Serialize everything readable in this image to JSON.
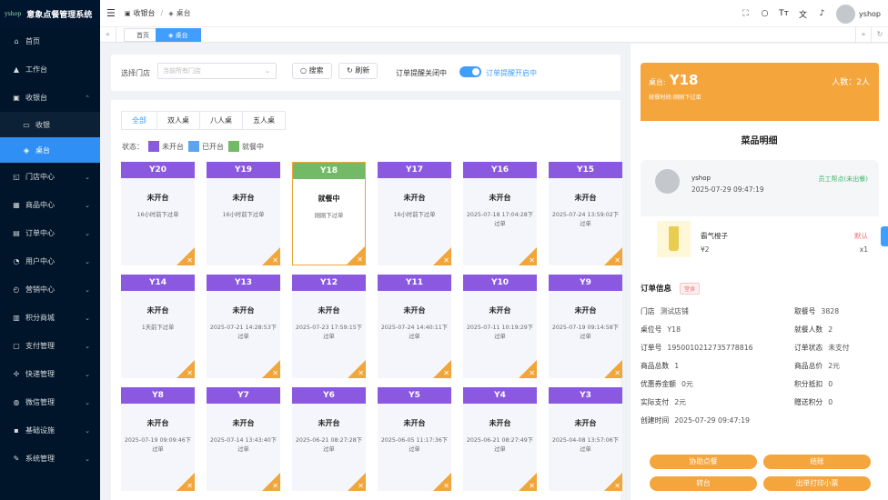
{
  "brand": {
    "logo": "yshop",
    "name": "意象点餐管理系统"
  },
  "menu": [
    {
      "label": "首页",
      "icon": "home-icon",
      "glyph": "⌂",
      "arrow": false
    },
    {
      "label": "工作台",
      "icon": "bell-icon",
      "glyph": "▲",
      "arrow": false
    },
    {
      "label": "收银台",
      "icon": "cashier-icon",
      "glyph": "▣",
      "arrow": true,
      "open": true
    },
    {
      "label": "收银",
      "icon": "monitor-icon",
      "glyph": "▭",
      "sub": true
    },
    {
      "label": "桌台",
      "icon": "table-icon",
      "glyph": "◈",
      "sub": true,
      "active": true
    },
    {
      "label": "门店中心",
      "icon": "store-icon",
      "glyph": "◱",
      "arrow": true
    },
    {
      "label": "商品中心",
      "icon": "goods-icon",
      "glyph": "▦",
      "arrow": true
    },
    {
      "label": "订单中心",
      "icon": "order-icon",
      "glyph": "▤",
      "arrow": true
    },
    {
      "label": "用户中心",
      "icon": "user-icon",
      "glyph": "◔",
      "arrow": true
    },
    {
      "label": "营销中心",
      "icon": "alarm-icon",
      "glyph": "◴",
      "arrow": true
    },
    {
      "label": "积分商城",
      "icon": "points-icon",
      "glyph": "▥",
      "arrow": true
    },
    {
      "label": "支付管理",
      "icon": "pay-icon",
      "glyph": "▢",
      "arrow": true
    },
    {
      "label": "快递管理",
      "icon": "delivery-icon",
      "glyph": "✢",
      "arrow": true
    },
    {
      "label": "微信管理",
      "icon": "wechat-icon",
      "glyph": "◍",
      "arrow": true
    },
    {
      "label": "基础设施",
      "icon": "grid-icon",
      "glyph": "▪",
      "arrow": true
    },
    {
      "label": "系统管理",
      "icon": "tool-icon",
      "glyph": "✎",
      "arrow": true
    }
  ],
  "breadcrumb": [
    "收银台",
    "桌台"
  ],
  "user": "yshop",
  "tabs": [
    "首页",
    "桌台"
  ],
  "filter": {
    "store_label": "选择门店",
    "store_placeholder": "当前所有门店",
    "search": "搜索",
    "refresh": "刷新",
    "notify_off": "订单提醒关闭中",
    "notify_on": "订单提醒开启中"
  },
  "type_tabs": [
    "全部",
    "双人桌",
    "八人桌",
    "五人桌"
  ],
  "legend": {
    "title": "状态：",
    "items": [
      {
        "label": "未开台",
        "color": "#8a59e0"
      },
      {
        "label": "已开台",
        "color": "#5da4f0"
      },
      {
        "label": "就餐中",
        "color": "#72b968"
      }
    ]
  },
  "colors": {
    "idle": "#8a59e0",
    "dining": "#72b968",
    "accent": "#409eff",
    "orange": "#f4a53c"
  },
  "tables": [
    {
      "name": "Y20",
      "status": "未开台",
      "time": "16小时前下过单",
      "state": "idle"
    },
    {
      "name": "Y19",
      "status": "未开台",
      "time": "16小时前下过单",
      "state": "idle"
    },
    {
      "name": "Y18",
      "status": "就餐中",
      "time": "刚刚下过单",
      "state": "dining"
    },
    {
      "name": "Y17",
      "status": "未开台",
      "time": "16小时前下过单",
      "state": "idle"
    },
    {
      "name": "Y16",
      "status": "未开台",
      "time": "2025-07-18 17:04:28下过单",
      "state": "idle"
    },
    {
      "name": "Y15",
      "status": "未开台",
      "time": "2025-07-24 13:59:02下过单",
      "state": "idle"
    },
    {
      "name": "Y14",
      "status": "未开台",
      "time": "1天前下过单",
      "state": "idle"
    },
    {
      "name": "Y13",
      "status": "未开台",
      "time": "2025-07-21 14:28:53下过单",
      "state": "idle"
    },
    {
      "name": "Y12",
      "status": "未开台",
      "time": "2025-07-23 17:59:15下过单",
      "state": "idle"
    },
    {
      "name": "Y11",
      "status": "未开台",
      "time": "2025-07-24 14:40:11下过单",
      "state": "idle"
    },
    {
      "name": "Y10",
      "status": "未开台",
      "time": "2025-07-11 10:19:29下过单",
      "state": "idle"
    },
    {
      "name": "Y9",
      "status": "未开台",
      "time": "2025-07-19 09:14:58下过单",
      "state": "idle"
    },
    {
      "name": "Y8",
      "status": "未开台",
      "time": "2025-07-19 09:09:46下过单",
      "state": "idle"
    },
    {
      "name": "Y7",
      "status": "未开台",
      "time": "2025-07-14 13:43:40下过单",
      "state": "idle"
    },
    {
      "name": "Y6",
      "status": "未开台",
      "time": "2025-06-21 08:27:28下过单",
      "state": "idle"
    },
    {
      "name": "Y5",
      "status": "未开台",
      "time": "2025-06-05 11:17:36下过单",
      "state": "idle"
    },
    {
      "name": "Y4",
      "status": "未开台",
      "time": "2025-06-21 08:27:49下过单",
      "state": "idle"
    },
    {
      "name": "Y3",
      "status": "未开台",
      "time": "2025-04-08 13:57:06下过单",
      "state": "idle"
    }
  ],
  "detail": {
    "table_label": "桌台:",
    "table": "Y18",
    "people": "人数：2人",
    "subtitle": "就餐时间:刚刚下过单",
    "title": "菜品明细",
    "order_user": "yshop",
    "order_time": "2025-07-29 09:47:19",
    "by": "员工帮点(未出餐)",
    "item": {
      "name": "霸气橙子",
      "price": "¥2",
      "tag": "默认",
      "qty": "x1"
    },
    "info_title": "订单信息",
    "info_badge": "堂食",
    "fields": [
      {
        "k": "门店",
        "v": "测试店铺"
      },
      {
        "k": "取餐号",
        "v": "3828"
      },
      {
        "k": "桌位号",
        "v": "Y18"
      },
      {
        "k": "就餐人数",
        "v": "2"
      },
      {
        "k": "订单号",
        "v": "1950010212735778816"
      },
      {
        "k": "订单状态",
        "v": "未支付"
      },
      {
        "k": "商品总数",
        "v": "1"
      },
      {
        "k": "商品总价",
        "v": "2元"
      },
      {
        "k": "优惠券金额",
        "v": "0元"
      },
      {
        "k": "积分抵扣",
        "v": "0"
      },
      {
        "k": "实际支付",
        "v": "2元"
      },
      {
        "k": "赠送积分",
        "v": "0"
      },
      {
        "k": "创建时间",
        "v": "2025-07-29 09:47:19"
      }
    ],
    "buttons": [
      "协助点餐",
      "结账",
      "转台",
      "出单打印小票"
    ]
  }
}
